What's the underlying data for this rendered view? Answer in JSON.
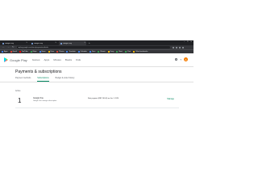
{
  "browser": {
    "tabs": [
      {
        "title": "Google Play",
        "active": false
      },
      {
        "title": "Google Play",
        "active": false
      },
      {
        "title": "Google Play",
        "active": true
      }
    ],
    "url": "play.google.com/store/paymentmethods",
    "bookmarks": [
      {
        "label": "Apps",
        "color": "#4285f4"
      },
      {
        "label": "Gmail",
        "color": "#ea4335"
      },
      {
        "label": "YouTube",
        "color": "#ff0000"
      },
      {
        "label": "Maps",
        "color": "#34a853"
      },
      {
        "label": "News",
        "color": "#4285f4"
      },
      {
        "label": "Drive",
        "color": "#fbbc04"
      },
      {
        "label": "Photos",
        "color": "#ea4335"
      },
      {
        "label": "Translate",
        "color": "#4285f4"
      },
      {
        "label": "Calendar",
        "color": "#4285f4"
      },
      {
        "label": "Docs",
        "color": "#4285f4"
      },
      {
        "label": "Sheets",
        "color": "#34a853"
      },
      {
        "label": "Keep",
        "color": "#fbbc04"
      },
      {
        "label": "Meet",
        "color": "#34a853"
      },
      {
        "label": "Chat",
        "color": "#34a853"
      },
      {
        "label": "Other bookmarks",
        "color": "#fbbc04"
      }
    ]
  },
  "header": {
    "app_name": "Google Play",
    "nav": [
      "Games",
      "Apps",
      "Movies",
      "Books",
      "Kids"
    ],
    "avatar_letter": "A"
  },
  "page": {
    "title": "Payments & subscriptions",
    "tabs": [
      {
        "label": "Payment methods",
        "active": false
      },
      {
        "label": "Subscriptions",
        "active": true
      },
      {
        "label": "Budget & order history",
        "active": false
      }
    ],
    "section_label": "Active",
    "subscription": {
      "count": "1",
      "title": "Google One",
      "subtitle": "Google One storage subscription",
      "info": "Next payment (INR 130.00) on Jan 1, 2024",
      "action": "Manage"
    }
  },
  "colors": {
    "accent": "#01875f",
    "chrome_dark": "#202124",
    "chrome_toolbar": "#35363a"
  }
}
